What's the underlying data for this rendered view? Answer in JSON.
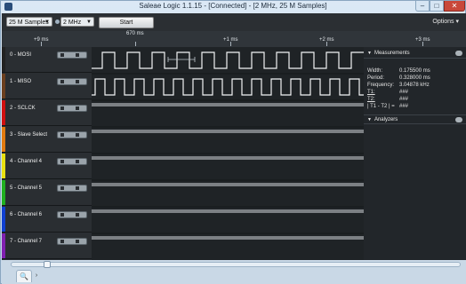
{
  "window": {
    "title": "Saleae Logic 1.1.15 - [Connected] - [2 MHz, 25 M Samples]"
  },
  "toolbar": {
    "samples_value": "25 M Samples",
    "rate_value": "2 MHz",
    "start_label": "Start",
    "options_label": "Options"
  },
  "timeline": {
    "top_marker": "670 ms",
    "labels": [
      "+9 ms",
      "+1 ms",
      "+2 ms",
      "+3 ms"
    ]
  },
  "channels": [
    {
      "name": "0 - MOSI",
      "color": "#222222"
    },
    {
      "name": "1 - MISO",
      "color": "#6b3f1f"
    },
    {
      "name": "2 - SCLCK",
      "color": "#d01010"
    },
    {
      "name": "3 - Slave Select",
      "color": "#e07a10"
    },
    {
      "name": "4 - Channel 4",
      "color": "#e8e010"
    },
    {
      "name": "5 - Channel 5",
      "color": "#20b020"
    },
    {
      "name": "6 - Channel 6",
      "color": "#1040d0"
    },
    {
      "name": "7 - Channel 7",
      "color": "#8020b0"
    }
  ],
  "measurements": {
    "title": "Measurements",
    "rows": [
      {
        "label": "Width:",
        "value": "0.175500 ms"
      },
      {
        "label": "Period:",
        "value": "0.328000 ms"
      },
      {
        "label": "Frequency:",
        "value": "3.04878 kHz"
      },
      {
        "label": "T1:",
        "value": "###"
      },
      {
        "label": "T2:",
        "value": "###"
      },
      {
        "label": "| T1 - T2 | =",
        "value": "###"
      }
    ]
  },
  "analyzers": {
    "title": "Analyzers"
  },
  "icons": {
    "search": "search-icon",
    "gear": "gear-icon",
    "next": "chevron-right-icon"
  }
}
